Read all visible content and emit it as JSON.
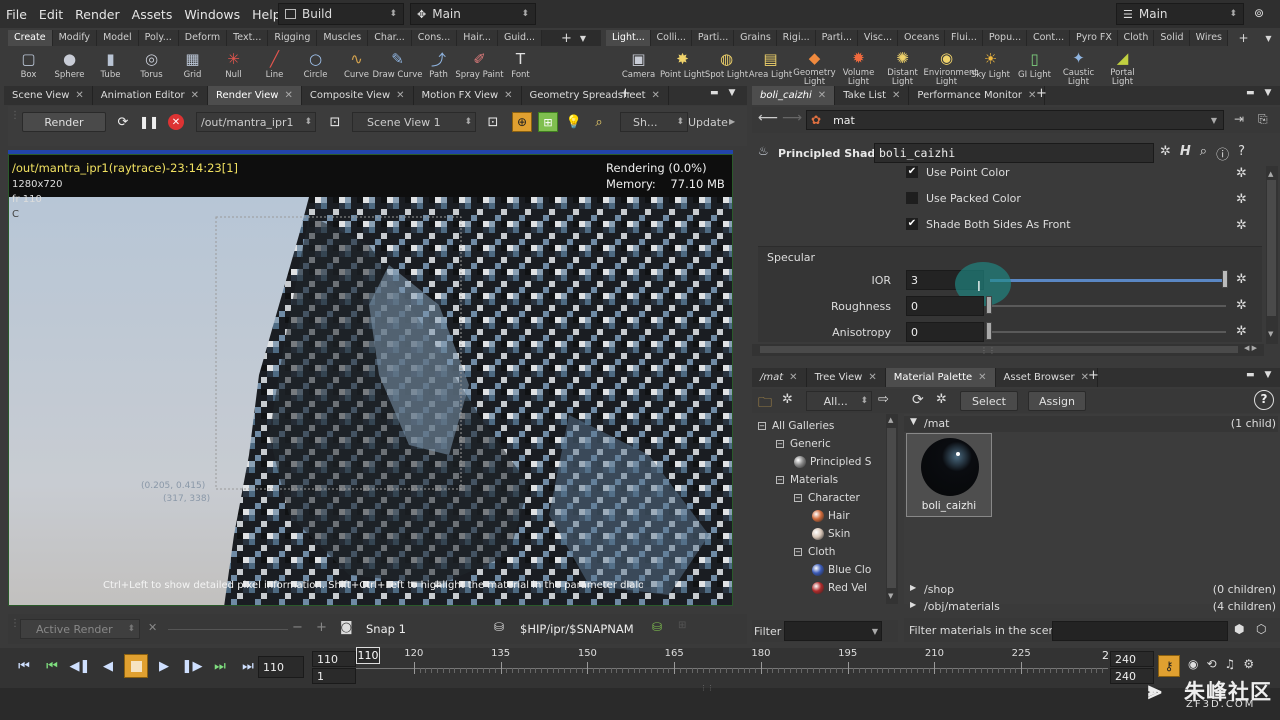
{
  "menubar": {
    "items": [
      "File",
      "Edit",
      "Render",
      "Assets",
      "Windows",
      "Help"
    ],
    "desktop_left": "Build",
    "desktop_mid": "Main",
    "desktop_right": "Main"
  },
  "shelf_left": {
    "tabs": [
      "Create",
      "Modify",
      "Model",
      "Poly...",
      "Deform",
      "Text...",
      "Rigging",
      "Muscles",
      "Char...",
      "Cons...",
      "Hair...",
      "Guid..."
    ],
    "tools": [
      {
        "label": "Box",
        "icon": "box-icon",
        "glyph": "▢",
        "color": "#b9c4d4"
      },
      {
        "label": "Sphere",
        "icon": "sphere-icon",
        "glyph": "●",
        "color": "#c8ccd6"
      },
      {
        "label": "Tube",
        "icon": "tube-icon",
        "glyph": "▮",
        "color": "#b9c4d4"
      },
      {
        "label": "Torus",
        "icon": "torus-icon",
        "glyph": "◎",
        "color": "#c8ccd6"
      },
      {
        "label": "Grid",
        "icon": "grid-icon",
        "glyph": "▦",
        "color": "#b9c4d4"
      },
      {
        "label": "Null",
        "icon": "null-icon",
        "glyph": "✳",
        "color": "#e2554e"
      },
      {
        "label": "Line",
        "icon": "line-icon",
        "glyph": "╱",
        "color": "#e2554e"
      },
      {
        "label": "Circle",
        "icon": "circle-icon",
        "glyph": "○",
        "color": "#9ec0ea"
      },
      {
        "label": "Curve",
        "icon": "curve-icon",
        "glyph": "∿",
        "color": "#d4a34e"
      },
      {
        "label": "Draw Curve",
        "icon": "draw-curve-icon",
        "glyph": "✎",
        "color": "#8fb4e0"
      },
      {
        "label": "Path",
        "icon": "path-icon",
        "glyph": "⤴",
        "color": "#8fb4e0"
      },
      {
        "label": "Spray Paint",
        "icon": "spray-paint-icon",
        "glyph": "✐",
        "color": "#e27d7d"
      },
      {
        "label": "Font",
        "icon": "font-icon",
        "glyph": "T",
        "color": "#e0e0e0"
      }
    ]
  },
  "shelf_right": {
    "tabs": [
      "Light...",
      "Colli...",
      "Parti...",
      "Grains",
      "Rigi...",
      "Parti...",
      "Visc...",
      "Oceans",
      "Flui...",
      "Popu...",
      "Cont...",
      "Pyro FX",
      "Cloth",
      "Solid",
      "Wires"
    ],
    "tools": [
      {
        "label": "Camera",
        "icon": "camera-icon",
        "glyph": "▣",
        "color": "#c8ccd6"
      },
      {
        "label": "Point Light",
        "icon": "point-light-icon",
        "glyph": "✸",
        "color": "#f0d36b"
      },
      {
        "label": "Spot Light",
        "icon": "spot-light-icon",
        "glyph": "◍",
        "color": "#f0d36b"
      },
      {
        "label": "Area Light",
        "icon": "area-light-icon",
        "glyph": "▤",
        "color": "#f0d36b"
      },
      {
        "label": "Geometry Light",
        "icon": "geometry-light-icon",
        "glyph": "◆",
        "color": "#f08a3e"
      },
      {
        "label": "Volume Light",
        "icon": "volume-light-icon",
        "glyph": "✹",
        "color": "#f06a3e"
      },
      {
        "label": "Distant Light",
        "icon": "distant-light-icon",
        "glyph": "✺",
        "color": "#f0d36b"
      },
      {
        "label": "Environment Light",
        "icon": "environment-light-icon",
        "glyph": "◉",
        "color": "#f0d36b"
      },
      {
        "label": "Sky Light",
        "icon": "sky-light-icon",
        "glyph": "☀",
        "color": "#f0b83e"
      },
      {
        "label": "GI Light",
        "icon": "gi-light-icon",
        "glyph": "▯",
        "color": "#7ed07e"
      },
      {
        "label": "Caustic Light",
        "icon": "caustic-light-icon",
        "glyph": "✦",
        "color": "#8fb4e0"
      },
      {
        "label": "Portal Light",
        "icon": "portal-light-icon",
        "glyph": "◢",
        "color": "#c0d040"
      }
    ]
  },
  "left_tabs": [
    "Scene View",
    "Animation Editor",
    "Render View",
    "Composite View",
    "Motion FX View",
    "Geometry Spreadsheet"
  ],
  "render_toolbar": {
    "render_label": "Render",
    "rop_path": "/out/mantra_ipr1",
    "camera": "Scene View 1",
    "shading": "Sh...",
    "update_label": "Update"
  },
  "viewport": {
    "title": "/out/mantra_ipr1(raytrace)-23:14:23[1]",
    "resolution": "1280x720",
    "frame": "fr 110",
    "channel": "C",
    "status": "Rendering (0.0%)",
    "memory": "Memory:    77.10 MB",
    "hint": "Ctrl+Left to show detailed pixel information. Shift+Ctrl+Left to highlight the material in the parameter dialog.",
    "coord1": "(0.205, 0.415)",
    "coord2": "(317, 338)"
  },
  "render_bottom": {
    "active_render": "Active Render",
    "snap": "Snap 1",
    "snap_path": "$HIP/ipr/$SNAPNAM"
  },
  "param_tabs": [
    "boli_caizhi",
    "Take List",
    "Performance Monitor"
  ],
  "param_path": "mat",
  "shader": {
    "type_label": "Principled Shader",
    "name": "boli_caizhi"
  },
  "params": {
    "checkboxes": [
      {
        "label": "Use Point Color",
        "checked": true
      },
      {
        "label": "Use Packed Color",
        "checked": false
      },
      {
        "label": "Shade Both Sides As Front",
        "checked": true
      }
    ],
    "section": "Specular",
    "ior_label": "IOR",
    "ior_value": "3",
    "ior_fraction": 1.0,
    "roughness_label": "Roughness",
    "roughness_value": "0",
    "anisotropy_label": "Anisotropy",
    "anisotropy_value": "0"
  },
  "mat_tabs": [
    "/mat",
    "Tree View",
    "Material Palette",
    "Asset Browser"
  ],
  "palette": {
    "filter_all": "All...",
    "select_label": "Select",
    "assign_label": "Assign",
    "tree": [
      {
        "label": "All Galleries",
        "level": 0
      },
      {
        "label": "Generic",
        "level": 1
      },
      {
        "label": "Principled S",
        "level": 2,
        "ball": "#888888"
      },
      {
        "label": "Materials",
        "level": 1
      },
      {
        "label": "Character",
        "level": 2
      },
      {
        "label": "Hair",
        "level": 3,
        "ball": "#d06a3a"
      },
      {
        "label": "Skin",
        "level": 3,
        "ball": "#d9c7b8"
      },
      {
        "label": "Cloth",
        "level": 2
      },
      {
        "label": "Blue Clo",
        "level": 3,
        "ball": "#3a5ab8"
      },
      {
        "label": "Red Vel",
        "level": 3,
        "ball": "#b02a2a"
      }
    ],
    "filter_label": "Filter",
    "groups": [
      {
        "path": "/mat",
        "count": "(1 child)"
      },
      {
        "path": "/shop",
        "count": "(0 children)"
      },
      {
        "path": "/obj/materials",
        "count": "(4 children)"
      }
    ],
    "material_name": "boli_caizhi",
    "filter_scene_label": "Filter materials in the scene:"
  },
  "timeline": {
    "current_frame": "110",
    "start_frame": "1",
    "range_start": "110",
    "ticks": [
      "120",
      "135",
      "150",
      "165",
      "180",
      "195",
      "210",
      "225"
    ],
    "end1": "240",
    "end2": "240",
    "end_short": "2"
  },
  "watermark": {
    "main": "朱峰社区",
    "sub": "ZF3D.COM"
  }
}
